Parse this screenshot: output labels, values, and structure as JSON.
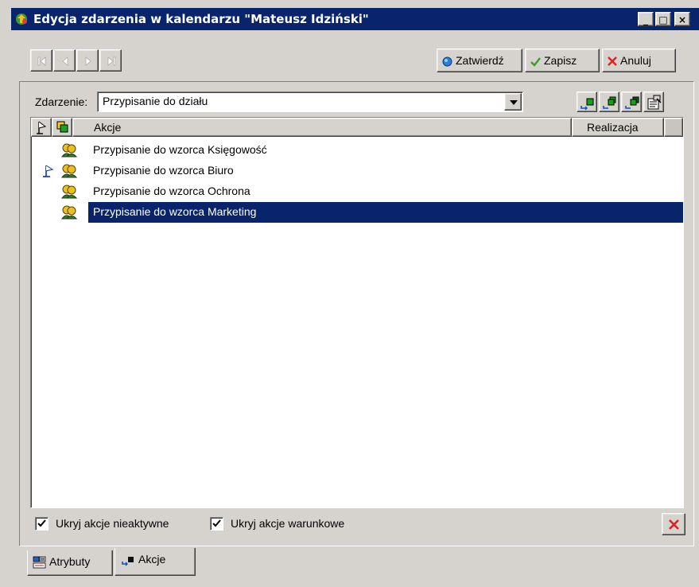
{
  "window": {
    "title": "Edycja zdarzenia w kalendarzu \"Mateusz Idziński\"",
    "minimize": "_",
    "maximize": "□",
    "close": "×"
  },
  "toolbar": {
    "nav": [
      "first-icon",
      "prev-icon",
      "next-icon",
      "last-icon"
    ],
    "confirm_label": "Zatwierdź",
    "save_label": "Zapisz",
    "cancel_label": "Anuluj"
  },
  "event": {
    "label": "Zdarzenie:",
    "value": "Przypisanie do działu"
  },
  "grid": {
    "columns": [
      "Akcje",
      "Realizacja"
    ],
    "rows": [
      {
        "text": "Przypisanie do wzorca Księgowość",
        "flag": false,
        "selected": false
      },
      {
        "text": "Przypisanie do wzorca Biuro",
        "flag": true,
        "selected": false
      },
      {
        "text": "Przypisanie do wzorca Ochrona",
        "flag": false,
        "selected": false
      },
      {
        "text": "Przypisanie do wzorca Marketing",
        "flag": false,
        "selected": true
      }
    ]
  },
  "options": {
    "hide_inactive_label": "Ukryj akcje nieaktywne",
    "hide_inactive_checked": true,
    "hide_conditional_label": "Ukryj akcje warunkowe",
    "hide_conditional_checked": true
  },
  "tabs": [
    {
      "label": "Atrybuty",
      "active": false
    },
    {
      "label": "Akcje",
      "active": true
    }
  ],
  "colors": {
    "titlebar": "#08246b",
    "selection": "#08246b",
    "face": "#d6d3ce"
  }
}
